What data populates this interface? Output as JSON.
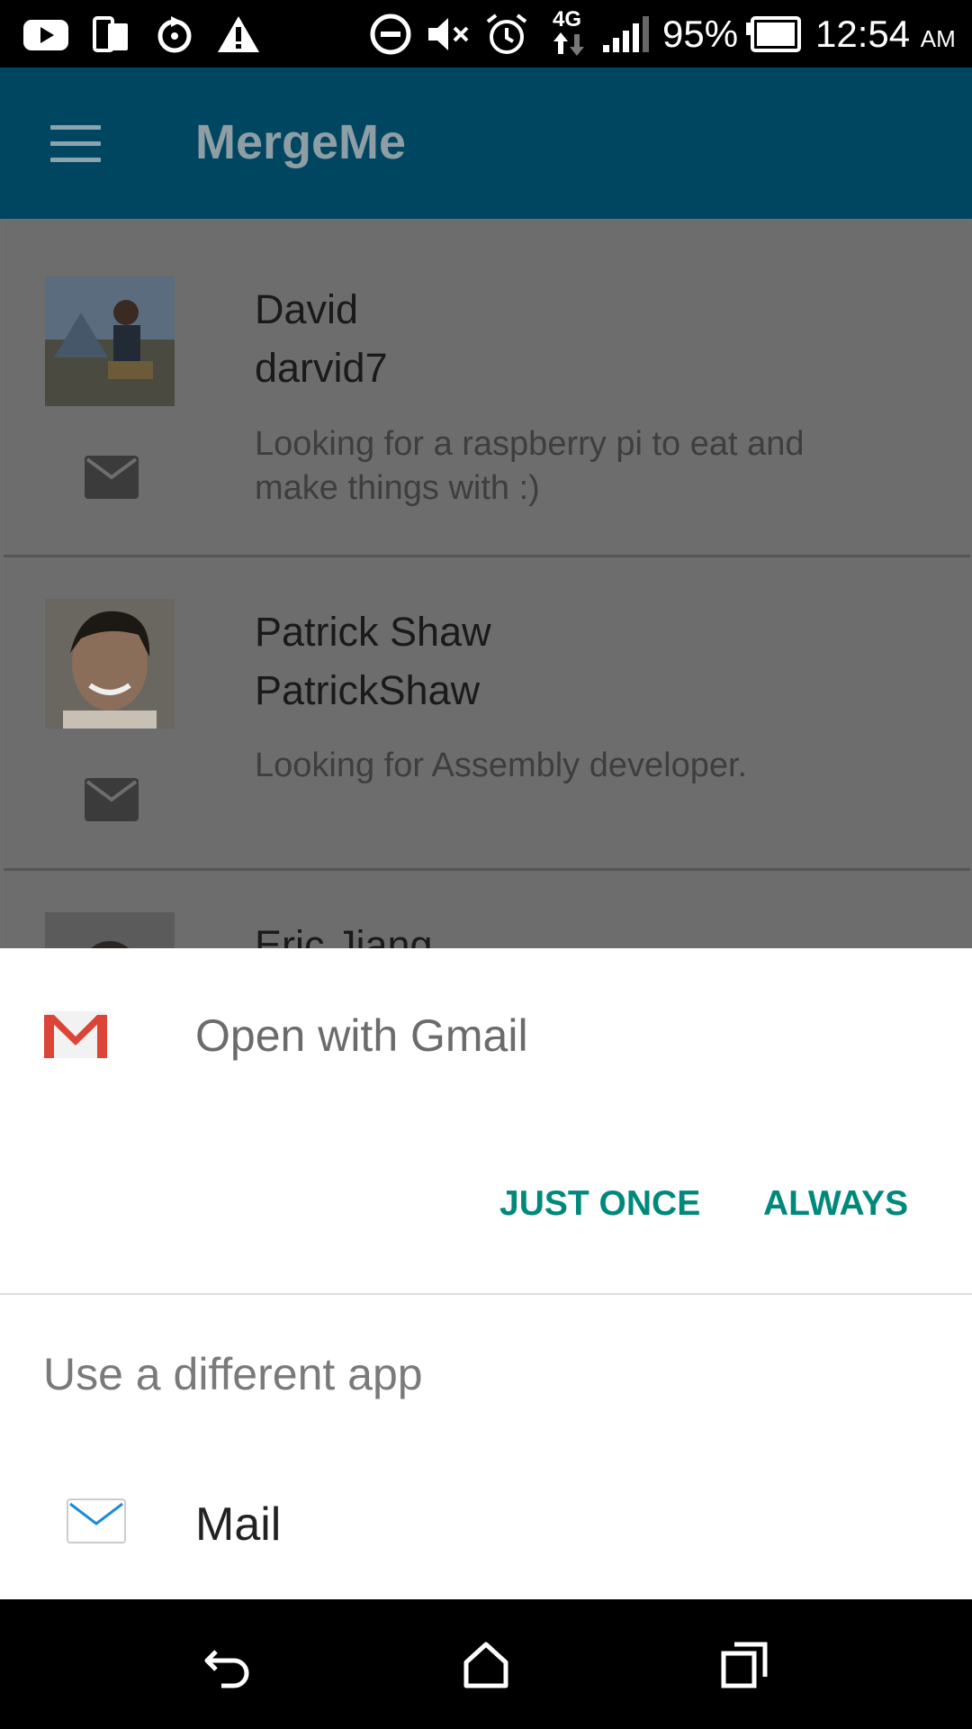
{
  "status_bar": {
    "battery_percent": "95%",
    "time": "12:54",
    "ampm": "AM",
    "network": "4G",
    "icons": [
      "youtube-icon",
      "phone-tablet-icon",
      "sync-icon",
      "warning-icon",
      "dnd-icon",
      "mute-icon",
      "alarm-icon",
      "signal-icon",
      "battery-icon"
    ]
  },
  "app_bar": {
    "title": "MergeMe"
  },
  "list": {
    "items": [
      {
        "name": "David",
        "username": "darvid7",
        "description": "Looking for a raspberry pi to eat and make things with :)"
      },
      {
        "name": "Patrick Shaw",
        "username": "PatrickShaw",
        "description": "Looking for Assembly developer."
      },
      {
        "name": "Eric Jiang",
        "username": "",
        "description": ""
      }
    ]
  },
  "sheet": {
    "title": "Open with Gmail",
    "just_once": "JUST ONCE",
    "always": "ALWAYS",
    "different_app": "Use a different app",
    "apps": [
      {
        "label": "Mail"
      }
    ]
  },
  "colors": {
    "app_bar": "#014661",
    "accent": "#00897b",
    "gmail_red": "#db4437"
  }
}
